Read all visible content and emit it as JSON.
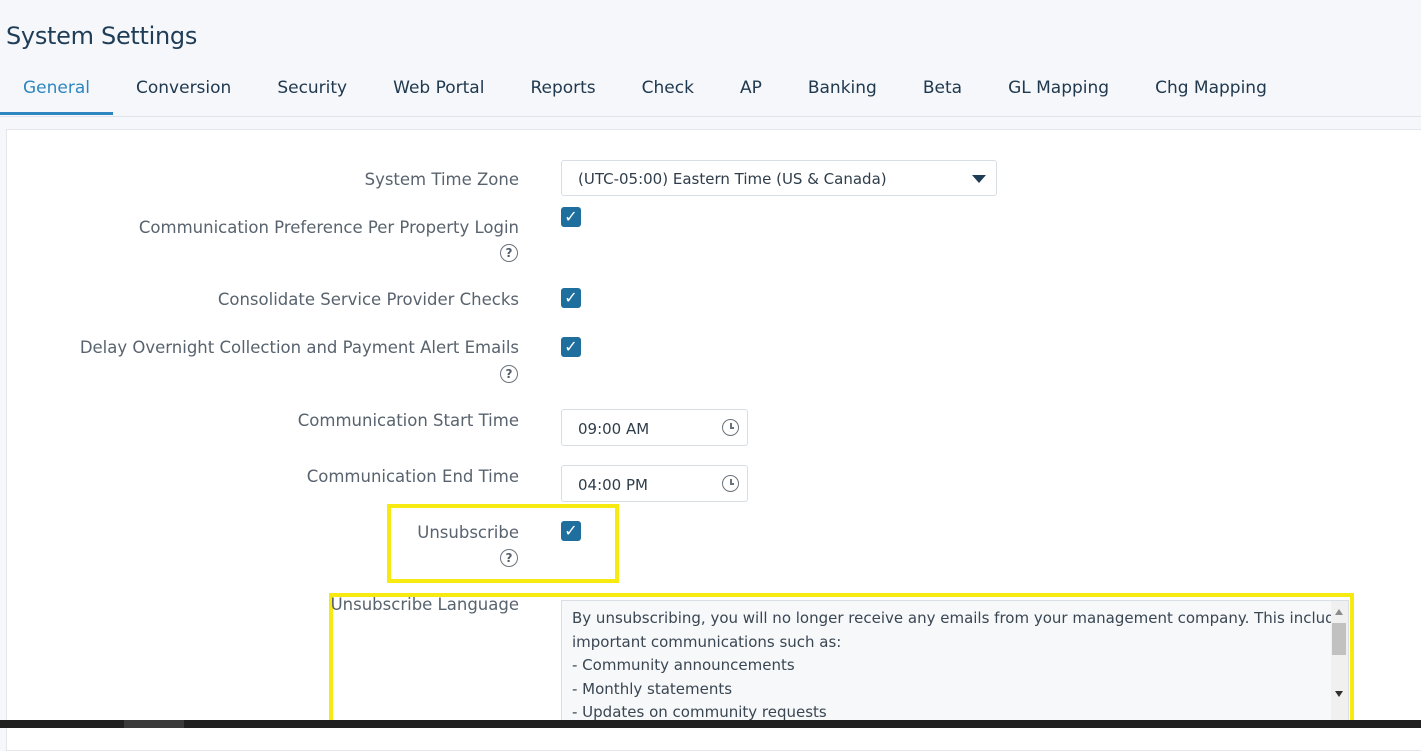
{
  "page": {
    "title": "System Settings"
  },
  "tabs": [
    {
      "label": "General",
      "active": true
    },
    {
      "label": "Conversion"
    },
    {
      "label": "Security"
    },
    {
      "label": "Web Portal"
    },
    {
      "label": "Reports"
    },
    {
      "label": "Check"
    },
    {
      "label": "AP"
    },
    {
      "label": "Banking"
    },
    {
      "label": "Beta"
    },
    {
      "label": "GL Mapping"
    },
    {
      "label": "Chg Mapping"
    }
  ],
  "settings": {
    "time_zone": {
      "label": "System Time Zone",
      "value": "(UTC-05:00) Eastern Time (US & Canada)"
    },
    "comm_pref": {
      "label": "Communication Preference Per Property Login",
      "checked": true,
      "help": "?"
    },
    "consolidate": {
      "label": "Consolidate Service Provider Checks",
      "checked": true
    },
    "delay_alerts": {
      "label": "Delay Overnight Collection and Payment Alert Emails",
      "checked": true,
      "help": "?"
    },
    "start_time": {
      "label": "Communication Start Time",
      "value": "09:00 AM"
    },
    "end_time": {
      "label": "Communication End Time",
      "value": "04:00 PM"
    },
    "unsubscribe": {
      "label": "Unsubscribe",
      "checked": true,
      "help": "?"
    },
    "unsubscribe_language": {
      "label": "Unsubscribe Language",
      "lines": [
        "By unsubscribing, you will no longer receive any emails from your management company. This includes",
        "important communications such as:",
        "- Community announcements",
        "- Monthly statements",
        "- Updates on community requests"
      ]
    }
  },
  "checkmark": "✓",
  "colors": {
    "accent": "#2e86c1",
    "checkbox": "#1f6f9e",
    "highlight": "#f7ea10",
    "title": "#1f3d57"
  }
}
